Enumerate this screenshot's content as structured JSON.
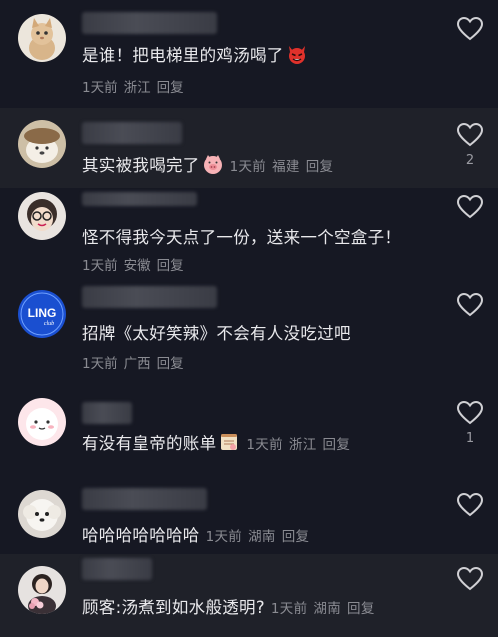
{
  "comments": [
    {
      "text": "是谁！把电梯里的鸡汤喝了",
      "emoji": "devil",
      "time": "1天前",
      "location": "浙江",
      "reply": "回复",
      "likes": ""
    },
    {
      "text": "其实被我喝完了",
      "emoji": "pig",
      "time": "1天前",
      "location": "福建",
      "reply": "回复",
      "likes": "2"
    },
    {
      "text": "怪不得我今天点了一份，送来一个空盒子！",
      "emoji": "",
      "time": "1天前",
      "location": "安徽",
      "reply": "回复",
      "likes": ""
    },
    {
      "text": "招牌《太好笑辣》不会有人没吃过吧",
      "emoji": "",
      "time": "1天前",
      "location": "广西",
      "reply": "回复",
      "likes": ""
    },
    {
      "text": "有没有皇帝的账单",
      "emoji": "scroll",
      "time": "1天前",
      "location": "浙江",
      "reply": "回复",
      "likes": "1"
    },
    {
      "text": "哈哈哈哈哈哈哈",
      "emoji": "",
      "time": "1天前",
      "location": "湖南",
      "reply": "回复",
      "likes": ""
    },
    {
      "text": "顾客:汤煮到如水般透明?",
      "emoji": "",
      "time": "1天前",
      "location": "湖南",
      "reply": "回复",
      "likes": ""
    }
  ],
  "avatars": {
    "c4_logo_text": "LING",
    "c4_logo_sub": "club"
  },
  "colors": {
    "background": "#161823",
    "shaded_row": "#1f2129",
    "meta_text": "#8a8b92"
  },
  "icons": {
    "like": "heart-outline-icon"
  }
}
